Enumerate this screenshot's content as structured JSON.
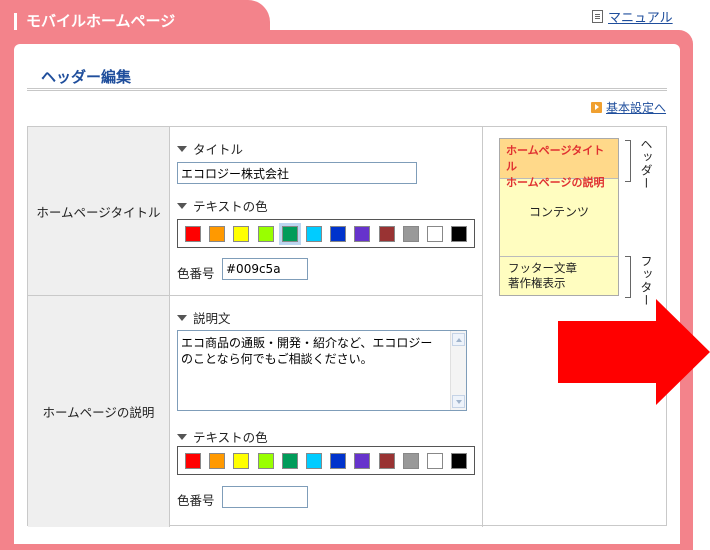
{
  "app": {
    "title": "モバイルホームページ"
  },
  "manual_link": "マニュアル",
  "section": {
    "title": "ヘッダー編集"
  },
  "basic_settings_link": "基本設定へ",
  "rows": [
    {
      "label": "ホームページタイトル",
      "text_field_label": "タイトル",
      "text_value": "エコロジー株式会社",
      "color_label": "テキストの色",
      "code_label": "色番号",
      "code_value": "#009c5a",
      "selected_color": "#009c5a"
    },
    {
      "label": "ホームページの説明",
      "text_field_label": "説明文",
      "text_value": "エコ商品の通販・開発・紹介など、エコロジーのことなら何でもご相談ください。",
      "color_label": "テキストの色",
      "code_label": "色番号",
      "code_value": "",
      "selected_color": ""
    }
  ],
  "palette": [
    "#ff0000",
    "#ff9900",
    "#ffff00",
    "#99ff00",
    "#009c5a",
    "#00ccff",
    "#0033cc",
    "#6633cc",
    "#993333",
    "#999999",
    "#ffffff",
    "#000000"
  ],
  "preview": {
    "header_line1": "ホームページタイトル",
    "header_line2": "ホームページの説明",
    "content": "コンテンツ",
    "footer_line1": "フッター文章",
    "footer_line2": "著作権表示",
    "header_tag": "ヘッダー",
    "footer_tag": "フッター"
  },
  "arrow_color": "#ff0000"
}
